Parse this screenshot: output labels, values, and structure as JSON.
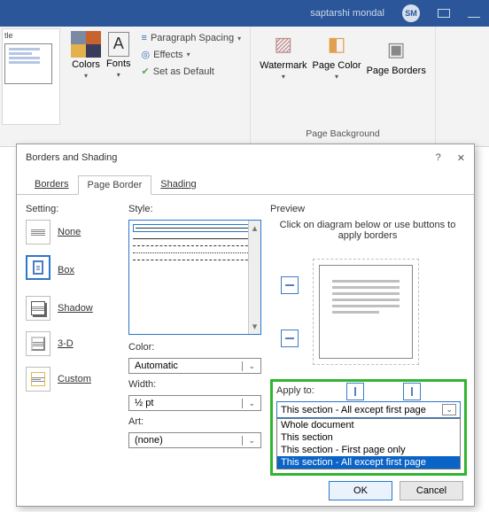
{
  "titlebar": {
    "user": "saptarshi mondal",
    "initials": "SM"
  },
  "ribbon": {
    "doc_caption": "tle",
    "colors_label": "Colors",
    "fonts_label": "Fonts",
    "para_spacing": "Paragraph Spacing",
    "effects": "Effects",
    "set_default": "Set as Default",
    "watermark": "Watermark",
    "page_color": "Page Color",
    "page_borders": "Page Borders",
    "bg_group": "Page Background"
  },
  "dialog": {
    "title": "Borders and Shading",
    "tabs": {
      "borders": "Borders",
      "page_border": "Page Border",
      "shading": "Shading"
    },
    "setting_hdr": "Setting:",
    "settings": {
      "none": "None",
      "box": "Box",
      "shadow": "Shadow",
      "d3": "3-D",
      "custom": "Custom"
    },
    "style_hdr": "Style:",
    "color_hdr": "Color:",
    "color_val": "Automatic",
    "width_hdr": "Width:",
    "width_val": "½ pt",
    "art_hdr": "Art:",
    "art_val": "(none)",
    "preview_hdr": "Preview",
    "preview_hint": "Click on diagram below or use buttons to apply borders",
    "apply_hdr": "Apply to:",
    "apply_sel": "This section - All except first page",
    "apply_opts": [
      "Whole document",
      "This section",
      "This section - First page only",
      "This section - All except first page"
    ],
    "ok": "OK",
    "cancel": "Cancel"
  }
}
